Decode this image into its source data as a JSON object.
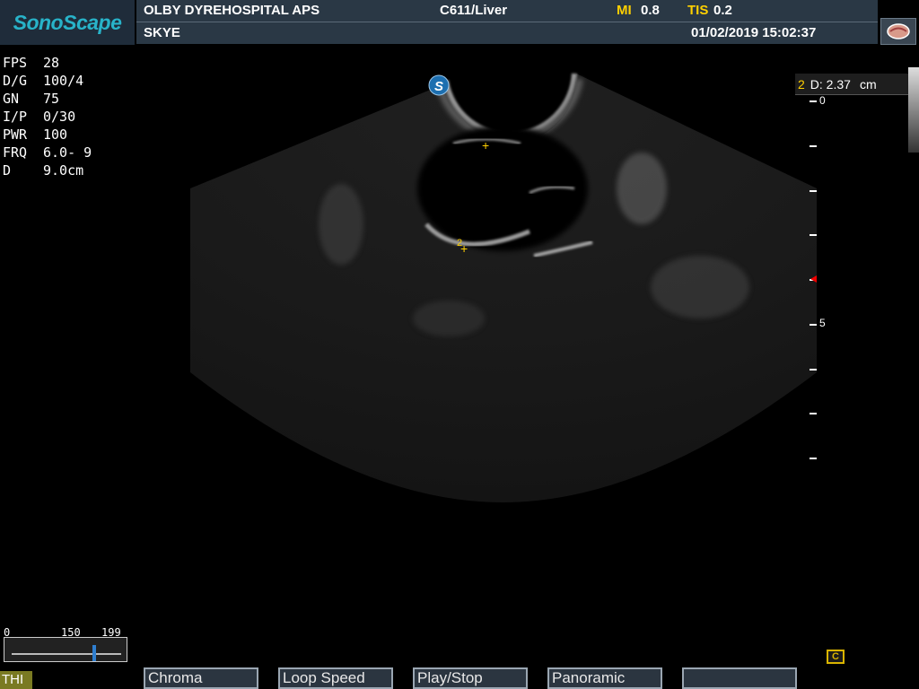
{
  "app": {
    "logo_text": "SonoScape"
  },
  "header": {
    "hospital": "OLBY DYREHOSPITAL APS",
    "probe_preset": "C611/Liver",
    "mi_label": "MI",
    "mi_value": "0.8",
    "tis_label": "TIS",
    "tis_value": "0.2",
    "patient": "SKYE",
    "datetime": "01/02/2019 15:02:37"
  },
  "params": [
    {
      "label": "FPS",
      "value": "28"
    },
    {
      "label": "D/G",
      "value": "100/4"
    },
    {
      "label": "GN",
      "value": "75"
    },
    {
      "label": "I/P",
      "value": "0/30"
    },
    {
      "label": "PWR",
      "value": "100"
    },
    {
      "label": "FRQ",
      "value": "6.0- 9"
    },
    {
      "label": "D",
      "value": "9.0cm"
    }
  ],
  "measurement": {
    "index": "2",
    "label": "D: 2.37",
    "unit": "cm"
  },
  "markers": {
    "m1": "+",
    "m2_index": "2",
    "m2": "+"
  },
  "orientation_mark": "S",
  "depth_scale": {
    "top": "0",
    "mid": "5",
    "max_cm": 9,
    "focus_cm": 4
  },
  "gain_slider": {
    "min": "0",
    "mid": "150",
    "max": "199",
    "value": 150
  },
  "mode_badge": "THI",
  "softkeys": [
    "Chroma",
    "Loop Speed",
    "Play/Stop",
    "Panoramic",
    ""
  ],
  "cine_icon": "C",
  "colors": {
    "accent_yellow": "#ffd000",
    "logo_teal": "#28b3c9",
    "header_bg": "#2a3845"
  }
}
